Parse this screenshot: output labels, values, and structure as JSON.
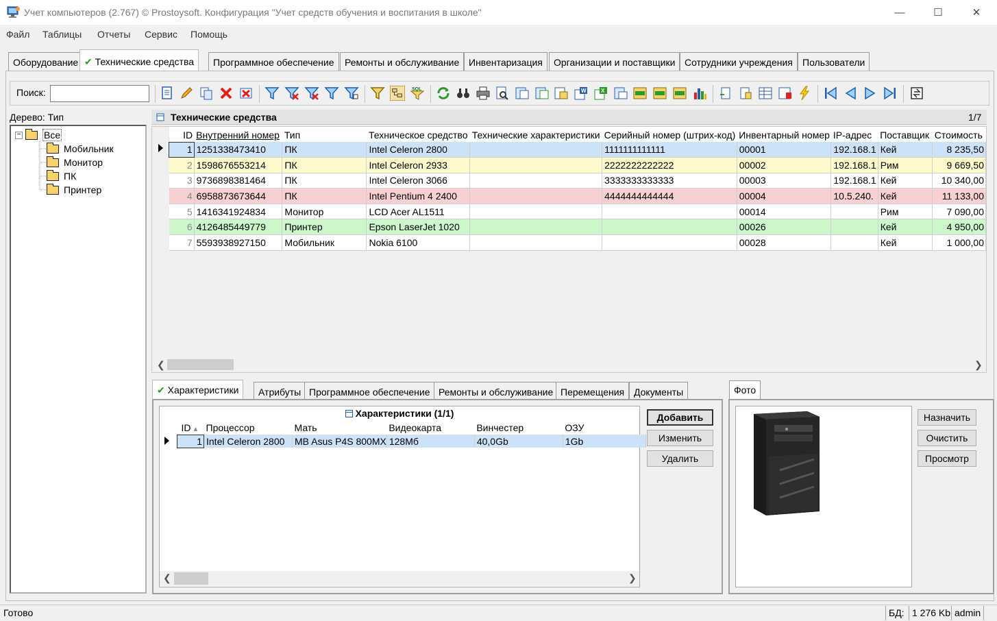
{
  "window": {
    "title": "Учет компьютеров (2.767) © Prostoysoft. Конфигурация \"Учет средств обучения и воспитания в школе\"",
    "minimize": "—",
    "maximize": "☐",
    "close": "✕"
  },
  "menu": [
    "Файл",
    "Таблицы",
    "Отчеты",
    "Сервис",
    "Помощь"
  ],
  "main_tabs": [
    "Оборудование",
    "Технические средства",
    "Программное обеспечение",
    "Ремонты и обслуживание",
    "Инвентаризация",
    "Организации и поставщики",
    "Сотрудники учреждения",
    "Пользователи"
  ],
  "active_tab_check": "✔",
  "search": {
    "label": "Поиск:",
    "value": ""
  },
  "tree": {
    "label": "Дерево: Тип",
    "root": "Все",
    "items": [
      "Мобильник",
      "Монитор",
      "ПК",
      "Принтер"
    ]
  },
  "grid": {
    "title": "Технические средства",
    "count": "1/7",
    "columns": [
      "ID",
      "Внутренний номер",
      "Тип",
      "Техническое средство",
      "Технические характеристики",
      "Серийный номер (штрих-код)",
      "Инвентарный номер",
      "IP-адрес",
      "Поставщик",
      "Стоимость"
    ],
    "rows": [
      {
        "id": "1",
        "internal": "1251338473410",
        "type": "ПК",
        "device": "Intel Celeron 2800",
        "specs": "",
        "serial": "1111111111111",
        "inv": "00001",
        "ip": "192.168.1",
        "supplier": "Кей",
        "cost": "8 235,50"
      },
      {
        "id": "2",
        "internal": "1598676553214",
        "type": "ПК",
        "device": "Intel Celeron 2933",
        "specs": "",
        "serial": "2222222222222",
        "inv": "00002",
        "ip": "192.168.1",
        "supplier": "Рим",
        "cost": "9 669,50"
      },
      {
        "id": "3",
        "internal": "9736898381464",
        "type": "ПК",
        "device": "Intel Celeron 3066",
        "specs": "",
        "serial": "3333333333333",
        "inv": "00003",
        "ip": "192.168.1",
        "supplier": "Кей",
        "cost": "10 340,00"
      },
      {
        "id": "4",
        "internal": "6958873673644",
        "type": "ПК",
        "device": "Intel Pentium 4 2400",
        "specs": "",
        "serial": "4444444444444",
        "inv": "00004",
        "ip": "10.5.240.",
        "supplier": "Кей",
        "cost": "11 133,00"
      },
      {
        "id": "5",
        "internal": "1416341924834",
        "type": "Монитор",
        "device": "LCD Acer AL1511",
        "specs": "",
        "serial": "",
        "inv": "00014",
        "ip": "",
        "supplier": "Рим",
        "cost": "7 090,00"
      },
      {
        "id": "6",
        "internal": "4126485449779",
        "type": "Принтер",
        "device": "Epson LaserJet 1020",
        "specs": "",
        "serial": "",
        "inv": "00026",
        "ip": "",
        "supplier": "Кей",
        "cost": "4 950,00"
      },
      {
        "id": "7",
        "internal": "5593938927150",
        "type": "Мобильник",
        "device": "Nokia 6100",
        "specs": "",
        "serial": "",
        "inv": "00028",
        "ip": "",
        "supplier": "Кей",
        "cost": "1 000,00"
      }
    ],
    "row_colors": [
      "row-blue",
      "row-yellow",
      "row-white",
      "row-red",
      "row-white",
      "row-green",
      "row-white"
    ]
  },
  "bottom_tabs": [
    "Характеристики",
    "Атрибуты",
    "Программное обеспечение",
    "Ремонты и обслуживание",
    "Перемещения",
    "Документы"
  ],
  "detail": {
    "title": "Характеристики (1/1)",
    "columns": [
      "ID",
      "Процессор",
      "Мать",
      "Видеокарта",
      "Винчестер",
      "ОЗУ"
    ],
    "sort_marker": "▲",
    "row": {
      "id": "1",
      "cpu": "Intel Celeron 2800",
      "mb": "MB Asus P4S 800MX",
      "gpu": "128Мб",
      "hdd": "40,0Gb",
      "ram": "1Gb"
    },
    "buttons": [
      "Добавить",
      "Изменить",
      "Удалить"
    ]
  },
  "photo": {
    "tab": "Фото",
    "buttons": [
      "Назначить",
      "Очистить",
      "Просмотр"
    ]
  },
  "status": {
    "left": "Готово",
    "db_label": "БД:",
    "db_size": "1 276 Kb",
    "user": "admin"
  }
}
